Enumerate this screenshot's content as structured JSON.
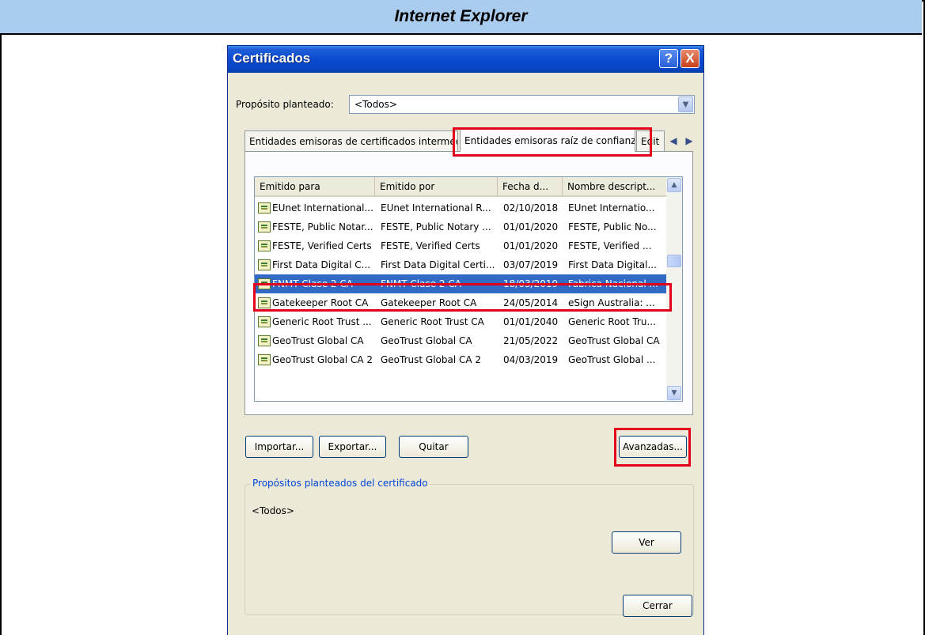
{
  "page_header": {
    "title": "Internet Explorer"
  },
  "dialog": {
    "title": "Certificados",
    "help_button": "?",
    "close_button": "X",
    "purpose_label": "Propósito planteado:",
    "purpose_value": "<Todos>",
    "tabs": [
      {
        "label": "Entidades emisoras de certificados intermedias"
      },
      {
        "label": "Entidades emisoras raíz de confianza"
      },
      {
        "label": "Edit"
      }
    ],
    "columns": [
      "Emitido para",
      "Emitido por",
      "Fecha d...",
      "Nombre descript..."
    ],
    "rows": [
      {
        "issued_to": "EUnet International...",
        "issued_by": "EUnet International R...",
        "date": "02/10/2018",
        "friendly_name": "EUnet Internatio..."
      },
      {
        "issued_to": "FESTE, Public Notar...",
        "issued_by": "FESTE, Public Notary ...",
        "date": "01/01/2020",
        "friendly_name": "FESTE, Public No..."
      },
      {
        "issued_to": "FESTE, Verified Certs",
        "issued_by": "FESTE, Verified Certs",
        "date": "01/01/2020",
        "friendly_name": "FESTE, Verified ..."
      },
      {
        "issued_to": "First Data Digital C...",
        "issued_by": "First Data Digital Certi...",
        "date": "03/07/2019",
        "friendly_name": "First Data Digital..."
      },
      {
        "issued_to": "FNMT Clase 2 CA",
        "issued_by": "FNMT Clase 2 CA",
        "date": "18/03/2019",
        "friendly_name": "Fabrica Nacional ...",
        "selected": true
      },
      {
        "issued_to": "Gatekeeper Root CA",
        "issued_by": "Gatekeeper Root CA",
        "date": "24/05/2014",
        "friendly_name": "eSign Australia: ..."
      },
      {
        "issued_to": "Generic Root Trust ...",
        "issued_by": "Generic Root Trust CA",
        "date": "01/01/2040",
        "friendly_name": "Generic Root Tru..."
      },
      {
        "issued_to": "GeoTrust Global CA",
        "issued_by": "GeoTrust Global CA",
        "date": "21/05/2022",
        "friendly_name": "GeoTrust Global CA"
      },
      {
        "issued_to": "GeoTrust Global CA 2",
        "issued_by": "GeoTrust Global CA 2",
        "date": "04/03/2019",
        "friendly_name": "GeoTrust Global ..."
      }
    ],
    "buttons": {
      "import": "Importar...",
      "export": "Exportar...",
      "remove": "Quitar",
      "advanced": "Avanzadas...",
      "view": "Ver",
      "close": "Cerrar"
    },
    "purposes_group": {
      "title": "Propósitos planteados del certificado",
      "value": "<Todos>"
    }
  },
  "colors": {
    "selection": "#316ac5",
    "highlight_box": "#e2001a",
    "header_band": "#aaccee",
    "dialog_bg": "#ece9d8"
  }
}
